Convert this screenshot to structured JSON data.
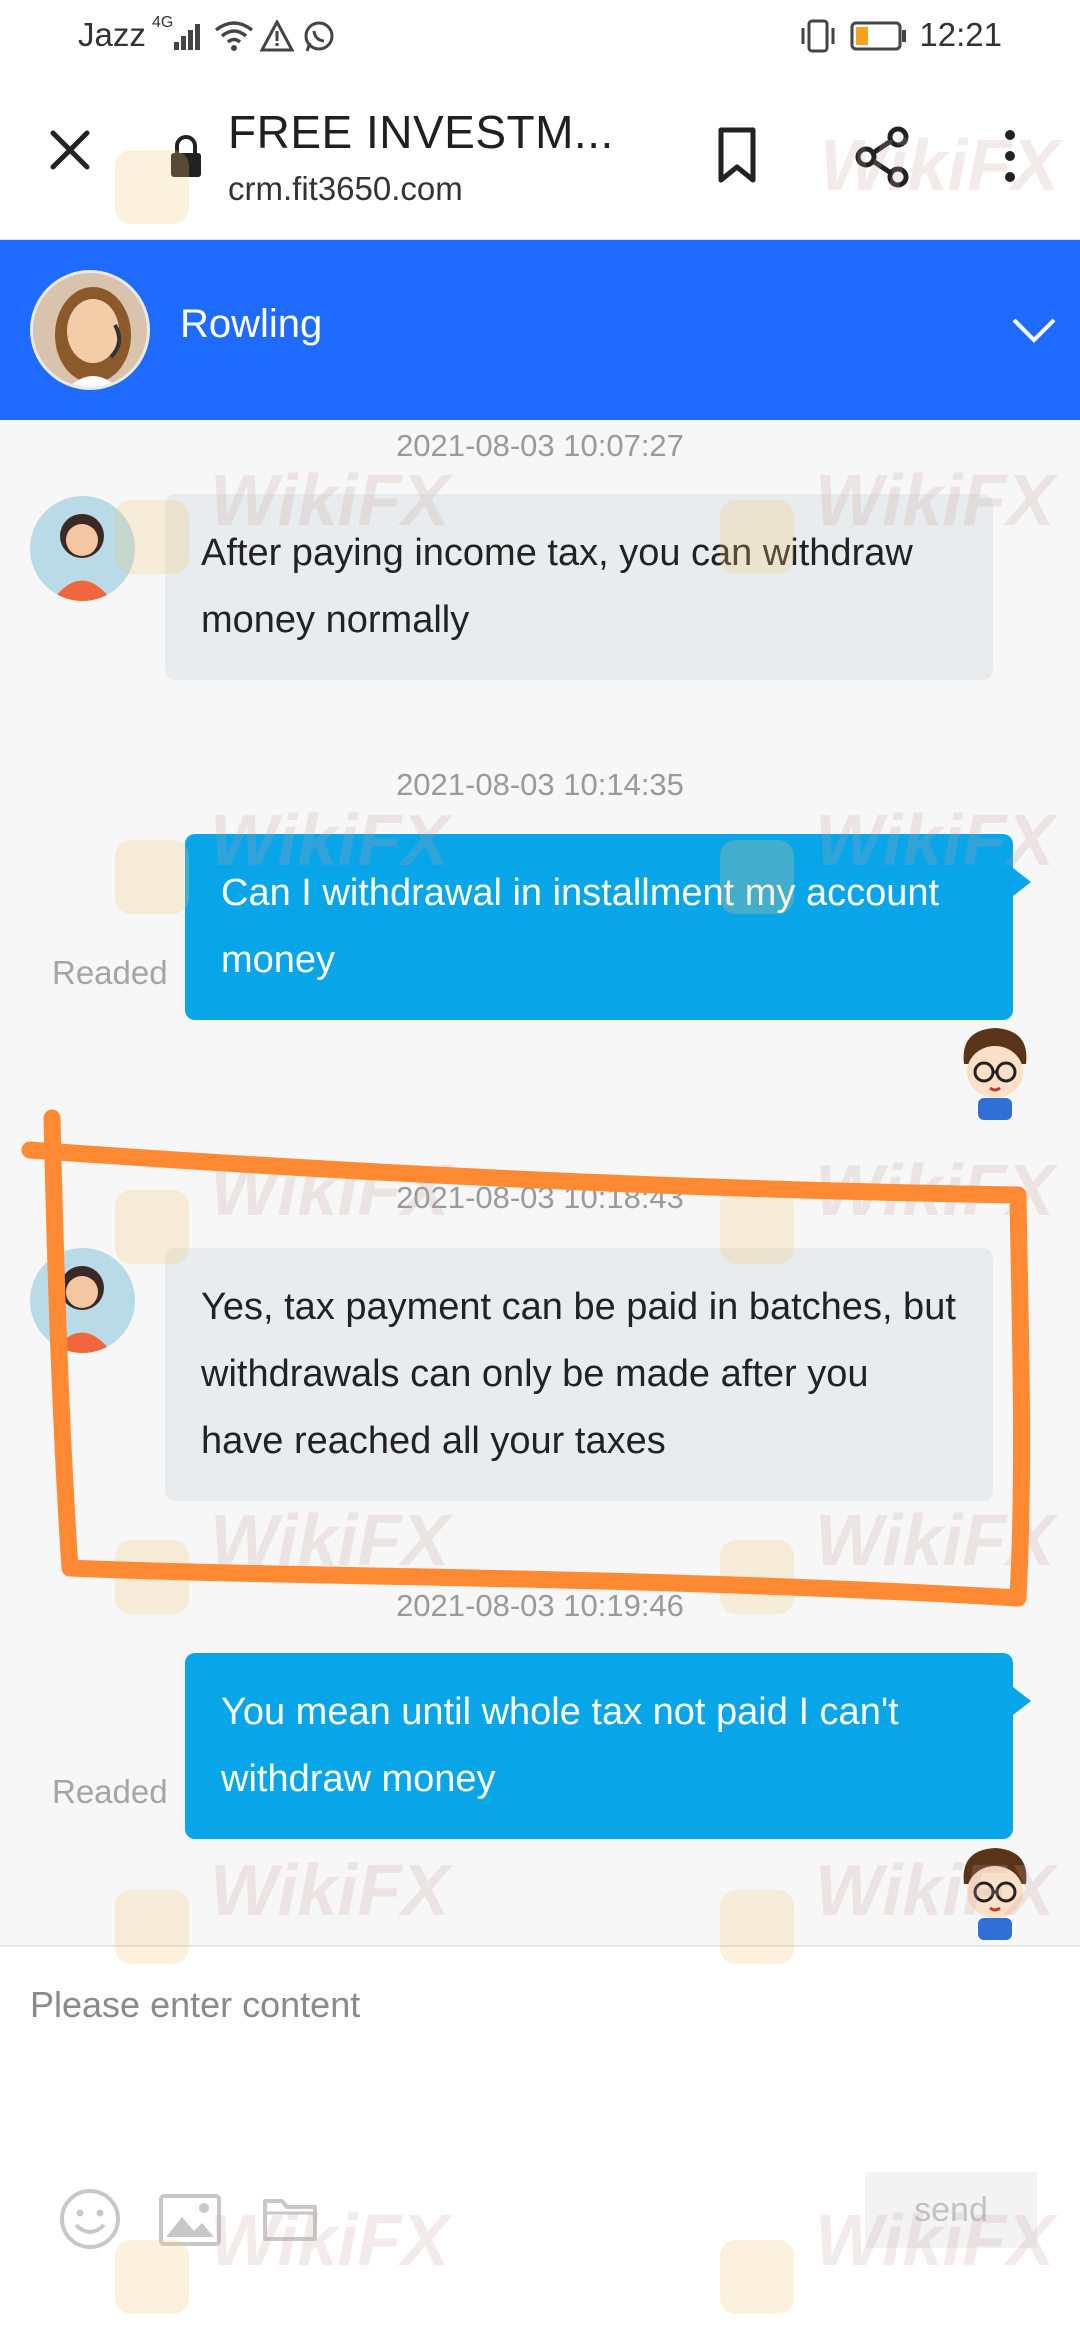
{
  "status_bar": {
    "carrier": "Jazz",
    "network": "4G",
    "time": "12:21",
    "icons": [
      "signal-icon",
      "wifi-icon",
      "warning-icon",
      "whatsapp-icon",
      "vibrate-icon",
      "battery-icon"
    ]
  },
  "browser": {
    "title": "FREE INVESTM...",
    "url": "crm.fit3650.com",
    "icons": [
      "close-icon",
      "lock-icon",
      "bookmark-icon",
      "share-icon",
      "more-icon"
    ]
  },
  "chat_header": {
    "agent_name": "Rowling",
    "color": "#1f6bff"
  },
  "messages": [
    {
      "timestamp": "2021-08-03 10:07:27",
      "direction": "incoming",
      "text": "After paying income tax, you can withdraw money normally"
    },
    {
      "timestamp": "2021-08-03 10:14:35",
      "direction": "outgoing",
      "text": "Can I withdrawal in installment my account money",
      "status": "Readed"
    },
    {
      "timestamp": "2021-08-03 10:18:43",
      "direction": "incoming",
      "text": "Yes, tax payment can be paid in batches, but withdrawals can only be made after you have reached all your taxes"
    },
    {
      "timestamp": "2021-08-03 10:19:46",
      "direction": "outgoing",
      "text": "You mean until whole tax not paid I can't withdraw money",
      "status": "Readed"
    }
  ],
  "input": {
    "placeholder": "Please enter content",
    "send_label": "send",
    "tools": [
      "emoji-icon",
      "image-icon",
      "folder-icon"
    ]
  },
  "watermark": "WikiFX",
  "colors": {
    "incoming_bubble": "#e8ecee",
    "outgoing_bubble": "#08a5e8",
    "annotation": "#ff8a33"
  }
}
